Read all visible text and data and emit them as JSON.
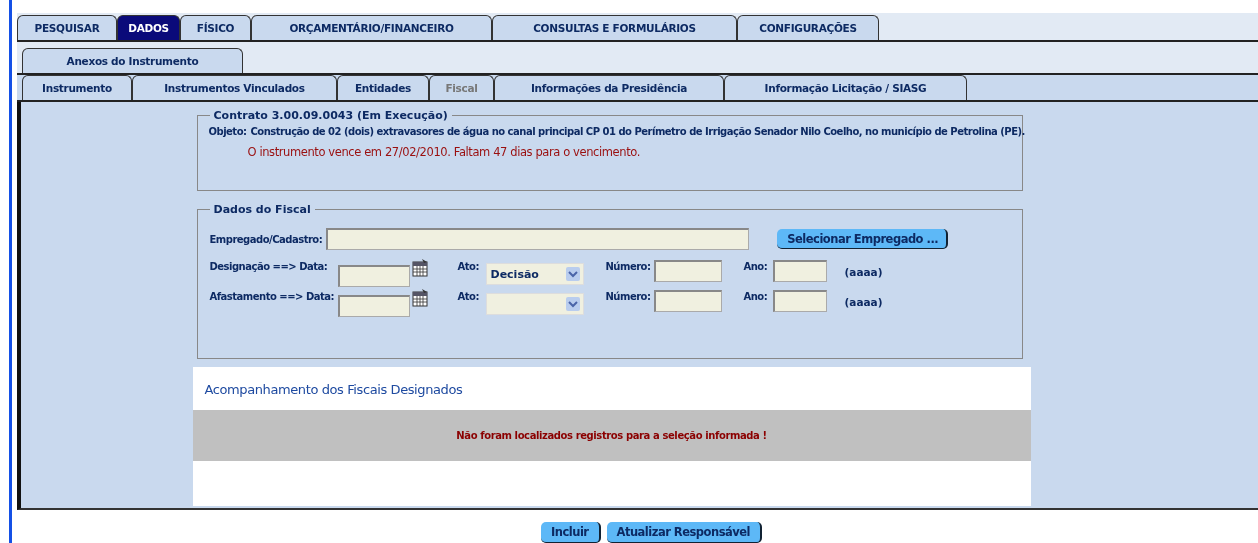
{
  "main_tabs": [
    {
      "label": "PESQUISAR",
      "selected": false
    },
    {
      "label": "DADOS",
      "selected": true
    },
    {
      "label": "FÍSICO",
      "selected": false
    },
    {
      "label": "ORÇAMENTÁRIO/FINANCEIRO",
      "selected": false
    },
    {
      "label": "CONSULTAS E FORMULÁRIOS",
      "selected": false
    },
    {
      "label": "CONFIGURAÇÕES",
      "selected": false
    }
  ],
  "secondary_tabs": [
    {
      "label": "Anexos do Instrumento",
      "selected": false
    }
  ],
  "sub_tabs": [
    {
      "label": "Instrumento",
      "selected": false
    },
    {
      "label": "Instrumentos Vinculados",
      "selected": false
    },
    {
      "label": "Entidades",
      "selected": false
    },
    {
      "label": "Fiscal",
      "selected": true
    },
    {
      "label": "Informações da Presidência",
      "selected": false
    },
    {
      "label": "Informação Licitação / SIASG",
      "selected": false
    }
  ],
  "contract": {
    "legend": "Contrato 3.00.09.0043 (Em Execução)",
    "object_label": "Objeto:",
    "object_text": "Construção de 02 (dois) extravasores de água no canal principal CP 01 do Perímetro de Irrigação Senador Nilo Coelho, no município de Petrolina (PE).",
    "warning": "O instrumento vence em 27/02/2010. Faltam 47 dias para o vencimento."
  },
  "fiscal": {
    "legend": "Dados do Fiscal",
    "employee_label": "Empregado/Cadastro:",
    "select_button": "Selecionar Empregado ...",
    "rows": [
      {
        "label": "Designação ==> Data:",
        "act_label": "Ato:",
        "act_value": "Decisão",
        "number_label": "Número:",
        "year_label": "Ano:",
        "year_hint": "(aaaa)"
      },
      {
        "label": "Afastamento ==> Data:",
        "act_label": "Ato:",
        "number_label": "Número:",
        "year_label": "Ano:",
        "year_hint": "(aaaa)"
      }
    ]
  },
  "tracking": {
    "title": "Acompanhamento dos Fiscais Designados",
    "empty_message": "Não foram localizados registros para a seleção informada !"
  },
  "buttons": [
    "Incluir",
    "Atualizar Responsável"
  ]
}
